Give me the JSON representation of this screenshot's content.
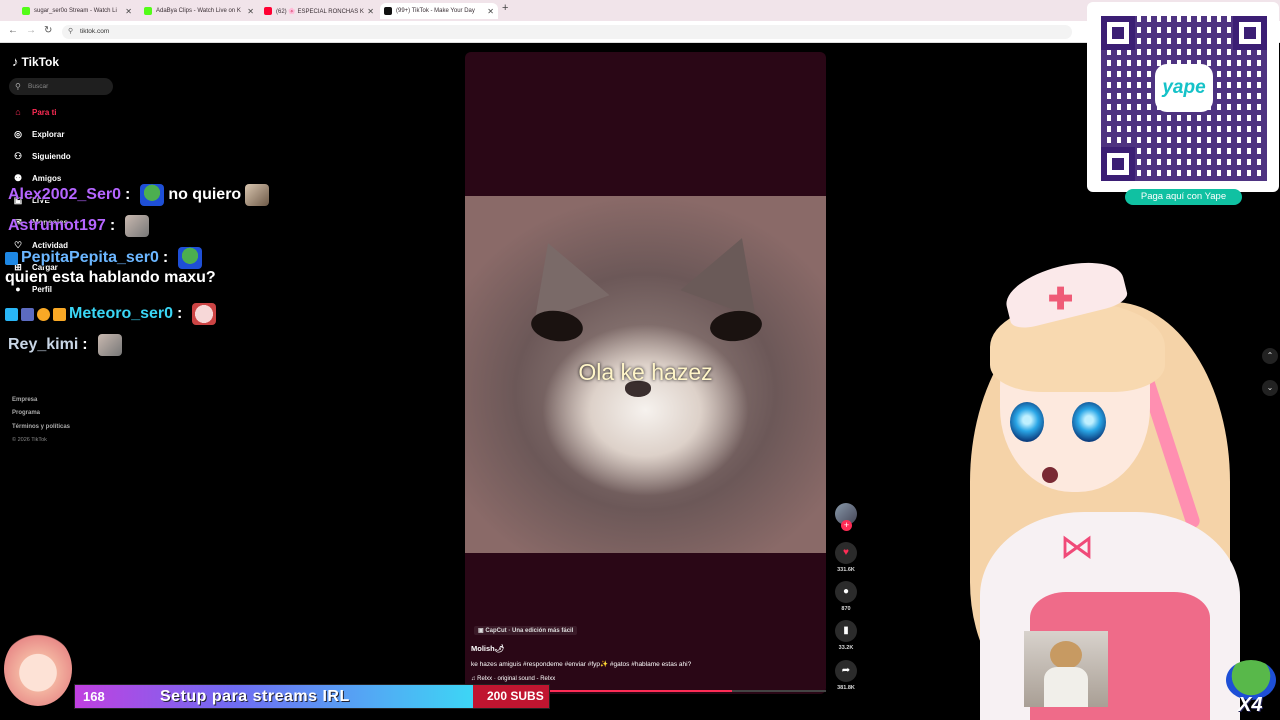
{
  "browser": {
    "tabs": [
      {
        "title": "sugar_ser0o Stream - Watch Li",
        "color": "#53fc18"
      },
      {
        "title": "AdaBya Clips - Watch Live on K",
        "color": "#53fc18"
      },
      {
        "title": "(62) 🌸 ESPECIAL RONCHAS K",
        "color": "#ff0033"
      },
      {
        "title": "(99+) TikTok - Make Your Day",
        "color": "#000000"
      }
    ],
    "url": "tiktok.com"
  },
  "tiktok": {
    "brand": "TikTok",
    "search_placeholder": "Buscar",
    "nav": [
      {
        "label": "Para ti",
        "icon": "home-icon"
      },
      {
        "label": "Explorar",
        "icon": "compass-icon"
      },
      {
        "label": "Siguiendo",
        "icon": "following-icon"
      },
      {
        "label": "Amigos",
        "icon": "friends-icon"
      },
      {
        "label": "LIVE",
        "icon": "live-icon"
      },
      {
        "label": "Mensajes",
        "icon": "message-icon"
      },
      {
        "label": "Actividad",
        "icon": "activity-icon"
      },
      {
        "label": "Cargar",
        "icon": "upload-icon"
      },
      {
        "label": "Perfil",
        "icon": "profile-icon"
      }
    ],
    "footer": [
      "Empresa",
      "Programa",
      "Términos y políticas"
    ],
    "copyright": "© 2026 TikTok",
    "video": {
      "overlay_text": "Ola ke hazez",
      "capcut_label": "CapCut · Una edición más fácil",
      "author": "Molish🌶",
      "description": "ke hazes amiguis #respondeme #enviar #fyp✨ #gatos #hablame estas ahi?",
      "music": "♫ Relxx · original sound - Relxx",
      "progress": 0.74
    },
    "actions": {
      "likes": "331.6K",
      "comments": "870",
      "saves": "33.2K",
      "shares": "381.8K"
    }
  },
  "chat": [
    {
      "user": "Alex2002_Ser0",
      "color": "#b565ff",
      "message": "no quiero"
    },
    {
      "user": "Astrumot197",
      "color": "#b565ff",
      "message": ""
    },
    {
      "user": "PepitaPepita_ser0",
      "color": "#6bb6ff",
      "message": "quien esta hablando maxu?"
    },
    {
      "user": "Meteoro_ser0",
      "color": "#3ad6f5",
      "message": ""
    },
    {
      "user": "Rey_kimi",
      "color": "#c9d6e6",
      "message": ""
    }
  ],
  "donation": {
    "button_label": "Paga aquí con Yape",
    "logo_text": "yape",
    "accent": "#10c1a2"
  },
  "stream_goal": {
    "current": "168",
    "title": "Setup para streams IRL",
    "target": "200 SUBS",
    "progress": 0.84
  },
  "overlay": {
    "multiplier": "X4"
  }
}
